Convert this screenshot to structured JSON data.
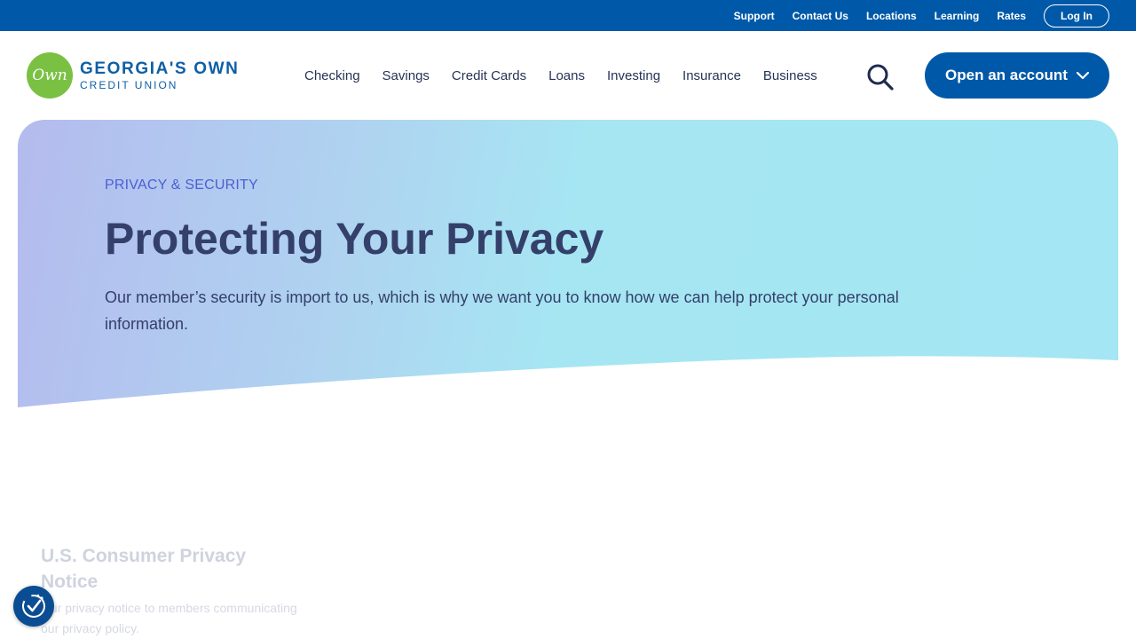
{
  "topbar": {
    "links": [
      "Support",
      "Contact Us",
      "Locations",
      "Learning",
      "Rates"
    ],
    "login_label": "Log In"
  },
  "logo": {
    "mark_text": "Own",
    "line1": "GEORGIA'S OWN",
    "line2": "CREDIT UNION"
  },
  "nav": {
    "items": [
      "Checking",
      "Savings",
      "Credit Cards",
      "Loans",
      "Investing",
      "Insurance",
      "Business"
    ],
    "search_icon": "search-icon",
    "open_account_label": "Open an account"
  },
  "hero": {
    "eyebrow": "PRIVACY & SECURITY",
    "title": "Protecting Your Privacy",
    "description": "Our member’s security is import to us, which is why we want you to know how we can help protect your personal information."
  },
  "cards": [
    {
      "title": "U.S. Consumer Privacy Notice",
      "text": "Our privacy notice to members communicating our privacy policy."
    }
  ],
  "colors": {
    "brand_blue": "#0059a8",
    "logo_green": "#7ac143",
    "hero_gradient_start": "#b4bbee",
    "hero_gradient_end": "#a4e6f3"
  }
}
